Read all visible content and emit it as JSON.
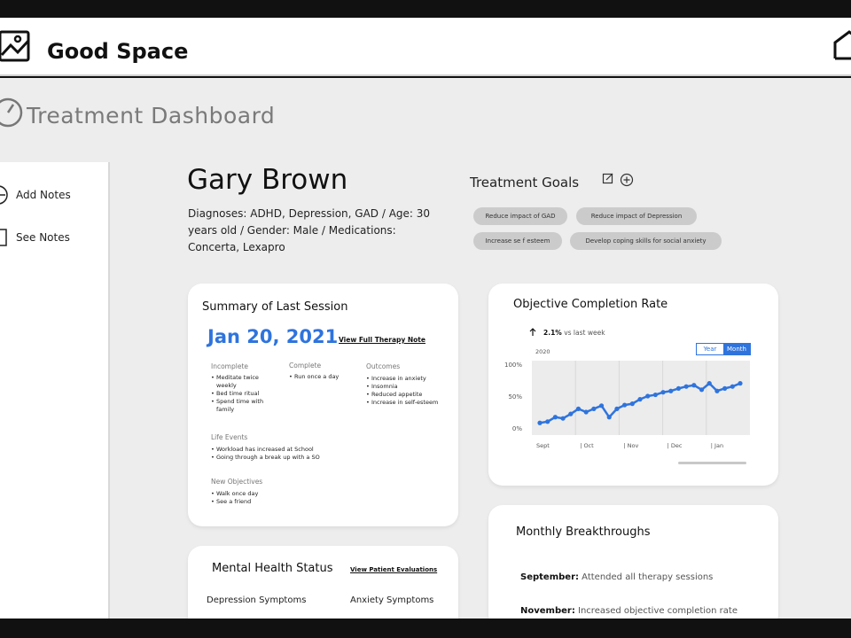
{
  "app": {
    "title": "Good Space"
  },
  "page": {
    "title": "Treatment Dashboard"
  },
  "sidebar": {
    "items": [
      {
        "label": "Add Notes",
        "icon": "add-notes-icon"
      },
      {
        "label": "See Notes",
        "icon": "notes-icon"
      }
    ]
  },
  "patient": {
    "name": "Gary Brown",
    "info": "Diagnoses: ADHD, Depression, GAD / Age: 30 years old / Gender: Male /  Medications: Concerta, Lexapro"
  },
  "goals": {
    "title": "Treatment Goals",
    "tags": [
      "Reduce impact of GAD",
      "Reduce impact of Depression",
      "Increase se f esteem",
      "Develop coping skills for social anxiety"
    ]
  },
  "summary": {
    "title": "Summary of Last Session",
    "date": "Jan 20, 2021",
    "link": "View Full Therapy Note",
    "incomplete_label": "Incomplete",
    "incomplete": [
      "Meditate twice weekly",
      "Bed time ritual",
      "Spend time with family"
    ],
    "complete_label": "Complete",
    "complete": [
      "Run once a day"
    ],
    "outcomes_label": "Outcomes",
    "outcomes": [
      "Increase in anxiety",
      "Insomnia",
      "Reduced appetite",
      "Increase in self-esteem"
    ],
    "life_events_label": "Life Events",
    "life_events": [
      "Workload has increased at School",
      "Going through a break up with a SO"
    ],
    "new_objectives_label": "New Objectives",
    "new_objectives": [
      "Walk once day",
      "See a friend"
    ]
  },
  "objective": {
    "title": "Objective Completion Rate",
    "trend_value": "2.1%",
    "trend_text": " vs last week",
    "year": "2020",
    "toggle_year": "Year",
    "toggle_month": "Month",
    "accent": "#2f74dd"
  },
  "chart_data": {
    "type": "line",
    "x": [
      "Sept",
      "",
      "",
      "",
      "",
      "",
      "",
      "",
      "Oct",
      "",
      "",
      "",
      "",
      "",
      "Nov",
      "",
      "",
      "",
      "Dec",
      "",
      "",
      "",
      "",
      "Jan",
      "",
      "",
      ""
    ],
    "x_tick_labels": [
      "Sept",
      "| Oct",
      "| Nov",
      "| Dec",
      "| Jan"
    ],
    "y_tick_labels": [
      "100%",
      "50%",
      "0%"
    ],
    "ylim": [
      0,
      100
    ],
    "series": [
      {
        "values": [
          8,
          10,
          17,
          15,
          22,
          30,
          25,
          30,
          35,
          17,
          30,
          36,
          38,
          45,
          50,
          52,
          56,
          58,
          62,
          65,
          67,
          60,
          70,
          58,
          62,
          65,
          70
        ]
      }
    ],
    "grid": true,
    "color": "#2f74dd"
  },
  "breakthroughs": {
    "title": "Monthly Breakthroughs",
    "items": [
      {
        "month": "September:",
        "text": " Attended all therapy sessions"
      },
      {
        "month": "November:",
        "text": " Increased objective completion rate"
      }
    ]
  },
  "mental_health": {
    "title": "Mental Health Status",
    "link": "View Patient Evaluations",
    "col1": "Depression Symptoms",
    "col2": "Anxiety Symptoms"
  }
}
